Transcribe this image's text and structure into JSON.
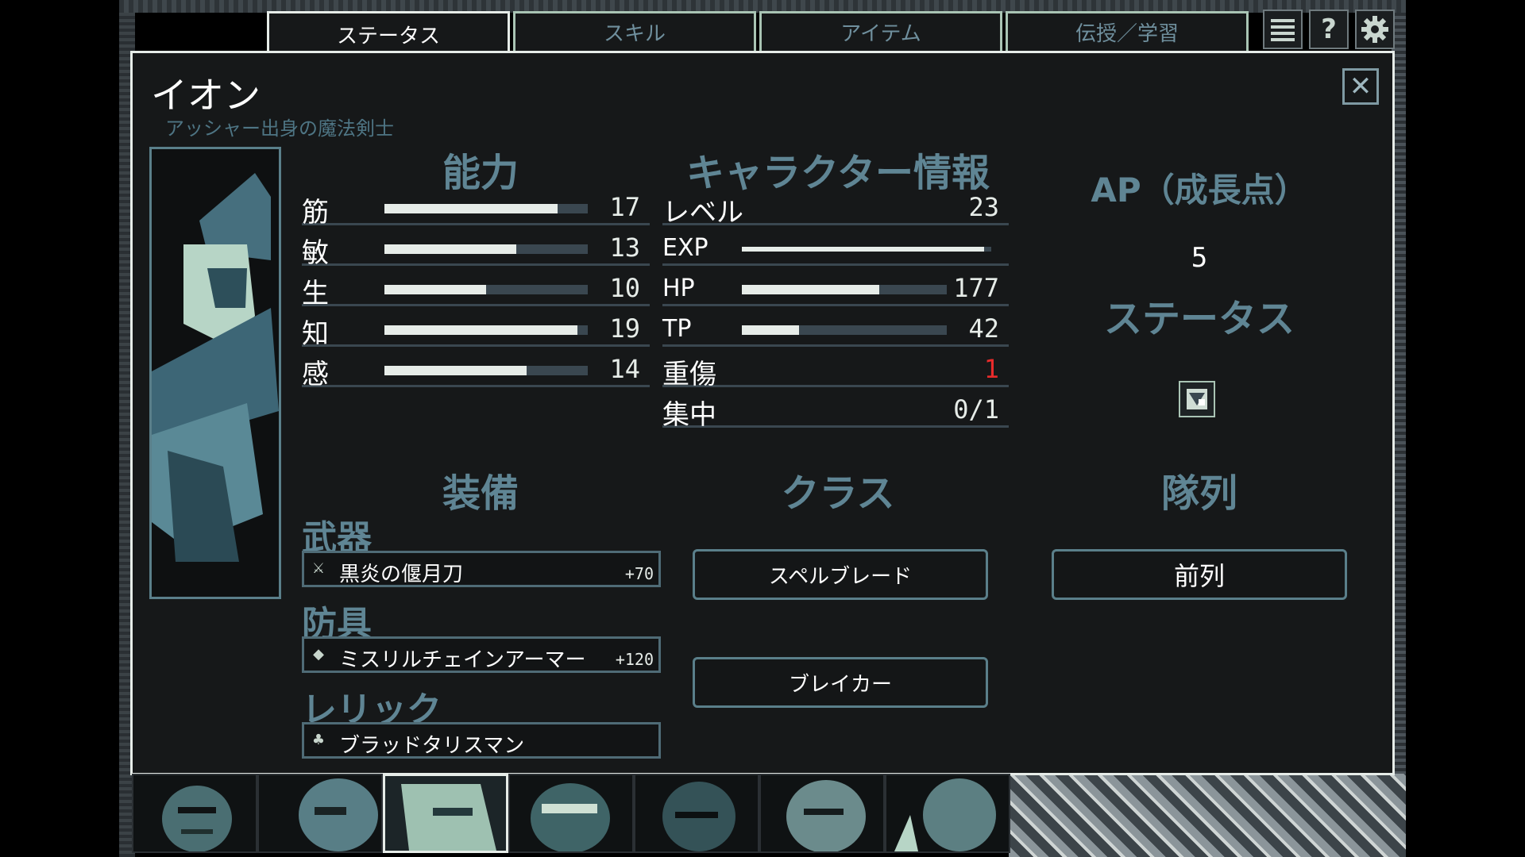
{
  "tabs": [
    {
      "label": "ステータス",
      "active": true
    },
    {
      "label": "スキル",
      "active": false
    },
    {
      "label": "アイテム",
      "active": false
    },
    {
      "label": "伝授／学習",
      "active": false
    }
  ],
  "top_icons": [
    "list-icon",
    "help-icon",
    "gear-icon"
  ],
  "character": {
    "name": "イオン",
    "subtitle": "アッシャー出身の魔法剣士"
  },
  "abilities": {
    "title": "能力",
    "stats": [
      {
        "label": "筋",
        "value": "17",
        "fill": 0.85
      },
      {
        "label": "敏",
        "value": "13",
        "fill": 0.65
      },
      {
        "label": "生",
        "value": "10",
        "fill": 0.5
      },
      {
        "label": "知",
        "value": "19",
        "fill": 0.95
      },
      {
        "label": "感",
        "value": "14",
        "fill": 0.7
      }
    ]
  },
  "character_info": {
    "title": "キャラクター情報",
    "level": {
      "label": "レベル",
      "value": "23"
    },
    "exp": {
      "label": "EXP",
      "fill": 0.97
    },
    "hp": {
      "label": "HP",
      "value": "177",
      "fill": 0.67
    },
    "tp": {
      "label": "TP",
      "value": "42",
      "fill": 0.28
    },
    "severe_wound": {
      "label": "重傷",
      "value": "1",
      "color": "#e82b2b"
    },
    "focus": {
      "label": "集中",
      "value": "0/1"
    }
  },
  "ap": {
    "title": "AP（成長点）",
    "value": "5"
  },
  "status": {
    "title": "ステータス",
    "icon": "status-effect-icon"
  },
  "equipment": {
    "title": "装備",
    "weapon": {
      "head": "武器",
      "name": "黒炎の偃月刀",
      "bonus": "+70",
      "icon": "sword-icon"
    },
    "armor": {
      "head": "防具",
      "name": "ミスリルチェインアーマー",
      "bonus": "+120",
      "icon": "armor-icon"
    },
    "relic": {
      "head": "レリック",
      "name": "ブラッドタリスマン",
      "icon": "talisman-icon"
    }
  },
  "class": {
    "title": "クラス",
    "primary": "スペルブレード",
    "secondary": "ブレイカー"
  },
  "formation": {
    "title": "隊列",
    "value": "前列"
  },
  "colors": {
    "accent": "#5f8594",
    "panel_bg": "#161819",
    "bar_fill": "#e6ece8",
    "bar_track": "#3a4750",
    "alert": "#e82b2b"
  },
  "party": {
    "count": 7,
    "selected_index": 2
  }
}
